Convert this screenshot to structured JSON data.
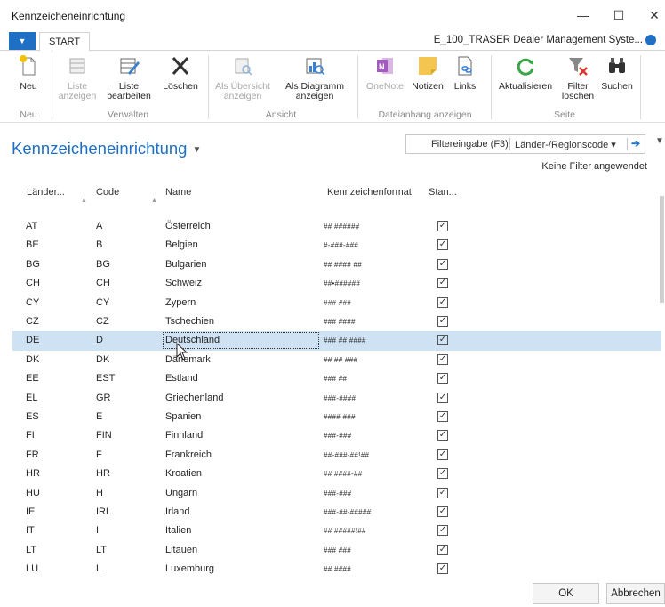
{
  "window": {
    "title": "Kennzeicheneinrichtung",
    "minimize": "—",
    "maximize": "☐",
    "close": "✕"
  },
  "tabs": {
    "appmenu": "▼",
    "start": "START",
    "company": "E_100_TRASER Dealer Management Syste..."
  },
  "ribbon": {
    "neu": "Neu",
    "liste_anzeigen_1": "Liste",
    "liste_anzeigen_2": "anzeigen",
    "liste_bearbeiten_1": "Liste",
    "liste_bearbeiten_2": "bearbeiten",
    "loeschen": "Löschen",
    "als_uebersicht_1": "Als Übersicht",
    "als_uebersicht_2": "anzeigen",
    "als_diagramm_1": "Als Diagramm",
    "als_diagramm_2": "anzeigen",
    "onenote": "OneNote",
    "notizen": "Notizen",
    "links": "Links",
    "aktualisieren": "Aktualisieren",
    "filter_loeschen_1": "Filter",
    "filter_loeschen_2": "löschen",
    "suchen": "Suchen",
    "groups": {
      "neu": "Neu",
      "verwalten": "Verwalten",
      "ansicht": "Ansicht",
      "dateianhang": "Dateianhang anzeigen",
      "seite": "Seite"
    }
  },
  "page": {
    "title": "Kennzeicheneinrichtung",
    "filter_input": "Filtereingabe (F3)",
    "filter_field": "Länder-/Regionscode ▾",
    "filter_go": "➔",
    "no_filter": "Keine Filter angewendet"
  },
  "columns": {
    "land": "Länder...",
    "code": "Code",
    "name": "Name",
    "format": "Kennzeichenformat",
    "standard": "Stan..."
  },
  "rows": [
    {
      "land": "AT",
      "code": "A",
      "name": "Österreich",
      "format": "## ######",
      "std": "✓"
    },
    {
      "land": "BE",
      "code": "B",
      "name": "Belgien",
      "format": "#-###-###",
      "std": "✓"
    },
    {
      "land": "BG",
      "code": "BG",
      "name": "Bulgarien",
      "format": "## #### ##",
      "std": "✓"
    },
    {
      "land": "CH",
      "code": "CH",
      "name": "Schweiz",
      "format": "##•######",
      "std": "✓"
    },
    {
      "land": "CY",
      "code": "CY",
      "name": "Zypern",
      "format": "### ###",
      "std": "✓"
    },
    {
      "land": "CZ",
      "code": "CZ",
      "name": "Tschechien",
      "format": "### ####",
      "std": "✓"
    },
    {
      "land": "DE",
      "code": "D",
      "name": "Deutschland",
      "format": "### ## ####",
      "std": "✓"
    },
    {
      "land": "DK",
      "code": "DK",
      "name": "Dänemark",
      "format": "## ## ###",
      "std": "✓"
    },
    {
      "land": "EE",
      "code": "EST",
      "name": "Estland",
      "format": "### ##",
      "std": "✓"
    },
    {
      "land": "EL",
      "code": "GR",
      "name": "Griechenland",
      "format": "###-####",
      "std": "✓"
    },
    {
      "land": "ES",
      "code": "E",
      "name": "Spanien",
      "format": "#### ###",
      "std": "✓"
    },
    {
      "land": "FI",
      "code": "FIN",
      "name": " Finnland",
      "format": "###-###",
      "std": "✓"
    },
    {
      "land": "FR",
      "code": "F",
      "name": "Frankreich",
      "format": "##-###-##!##",
      "std": "✓"
    },
    {
      "land": "HR",
      "code": "HR",
      "name": "Kroatien",
      "format": "## ####-##",
      "std": "✓"
    },
    {
      "land": "HU",
      "code": "H",
      "name": "Ungarn",
      "format": "###-###",
      "std": "✓"
    },
    {
      "land": "IE",
      "code": "IRL",
      "name": "Irland",
      "format": "###-##-#####",
      "std": "✓"
    },
    {
      "land": "IT",
      "code": "I",
      "name": "Italien",
      "format": "## #####!##",
      "std": "✓"
    },
    {
      "land": "LT",
      "code": "LT",
      "name": "Litauen",
      "format": "### ###",
      "std": "✓"
    },
    {
      "land": "LU",
      "code": "L",
      "name": "Luxemburg",
      "format": "## ####",
      "std": "✓"
    }
  ],
  "selected_row": 6,
  "buttons": {
    "ok": "OK",
    "cancel": "Abbrechen"
  },
  "colors": {
    "accent": "#1f6fc5",
    "selection": "#cfe2f3"
  }
}
